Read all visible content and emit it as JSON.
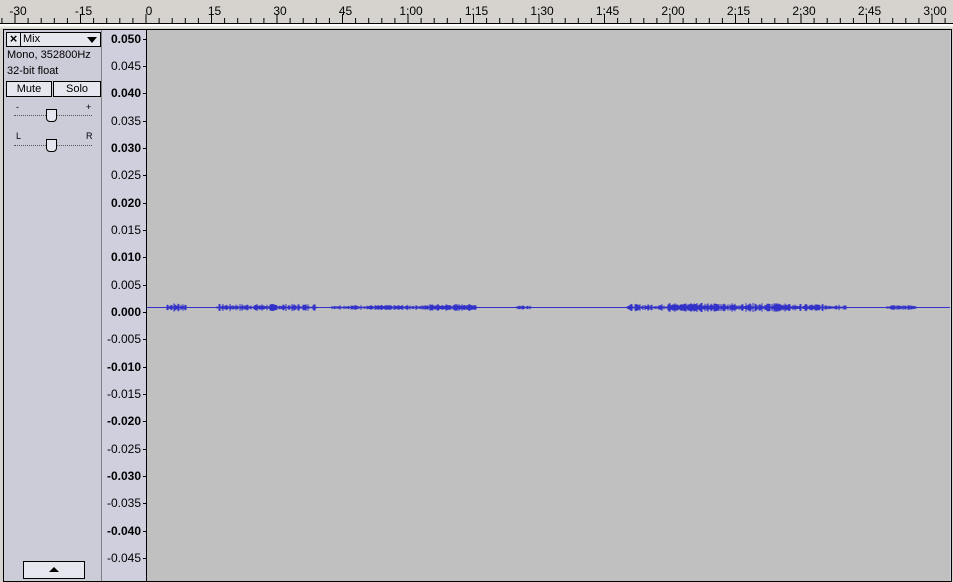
{
  "ruler": {
    "labels": [
      "-30",
      "-15",
      "0",
      "15",
      "30",
      "45",
      "1:00",
      "1:15",
      "1:30",
      "1:45",
      "2:00",
      "2:15",
      "2:30",
      "2:45",
      "3:00"
    ]
  },
  "track": {
    "name": "Mix",
    "format": "Mono, 352800Hz",
    "sample_format": "32-bit float",
    "mute_label": "Mute",
    "solo_label": "Solo",
    "gain_minus": "-",
    "gain_plus": "+",
    "pan_left": "L",
    "pan_right": "R",
    "gain_level": 0.48,
    "pan_level": 0.48
  },
  "vertical_ruler": {
    "labels": [
      "0.050",
      "0.045",
      "0.040",
      "0.035",
      "0.030",
      "0.025",
      "0.020",
      "0.015",
      "0.010",
      "0.005",
      "0.000",
      "-0.005",
      "-0.010",
      "-0.015",
      "-0.020",
      "-0.025",
      "-0.030",
      "-0.035",
      "-0.040",
      "-0.045"
    ],
    "bold": [
      true,
      false,
      true,
      false,
      true,
      false,
      true,
      false,
      true,
      false,
      true,
      false,
      true,
      false,
      true,
      false,
      true,
      false,
      true,
      false
    ]
  },
  "waveform": {
    "color": "#3232c8",
    "background": "#c0c0c0"
  }
}
